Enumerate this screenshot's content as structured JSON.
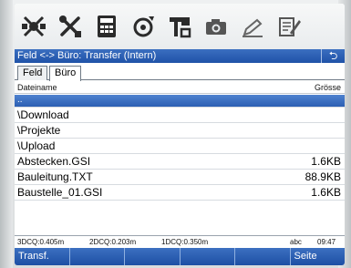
{
  "toolbar": {
    "icons": [
      "satellite-icon",
      "tools-icon",
      "keypad-icon",
      "settings-wheel-icon",
      "survey-tool-icon",
      "camera-icon",
      "pen-icon",
      "document-edit-icon"
    ]
  },
  "window": {
    "title": "Feld <-> Büro: Transfer (Intern)",
    "close_glyph": "⮌"
  },
  "tabs": [
    {
      "label": "Feld"
    },
    {
      "label": "Büro"
    }
  ],
  "columns": {
    "name": "Dateiname",
    "size": "Grösse"
  },
  "files": [
    {
      "name": "..",
      "size": ""
    },
    {
      "name": "\\Download",
      "size": ""
    },
    {
      "name": "\\Projekte",
      "size": ""
    },
    {
      "name": "\\Upload",
      "size": ""
    },
    {
      "name": "Abstecken.GSI",
      "size": "1.6KB"
    },
    {
      "name": "Bauleitung.TXT",
      "size": "88.9KB"
    },
    {
      "name": "Baustelle_01.GSI",
      "size": "1.6KB"
    }
  ],
  "status": {
    "cq3d": "3DCQ:0.405m",
    "cq2d": "2DCQ:0.203m",
    "cq1d": "1DCQ:0.350m",
    "input_mode": "abc",
    "time": "09:47"
  },
  "softkeys": [
    "Transf.",
    "",
    "",
    "",
    "",
    "Seite"
  ],
  "colors": {
    "title_bar": "#2a5db0",
    "selection": "#3d70c2",
    "softkey_bar": "#2a5db0"
  }
}
